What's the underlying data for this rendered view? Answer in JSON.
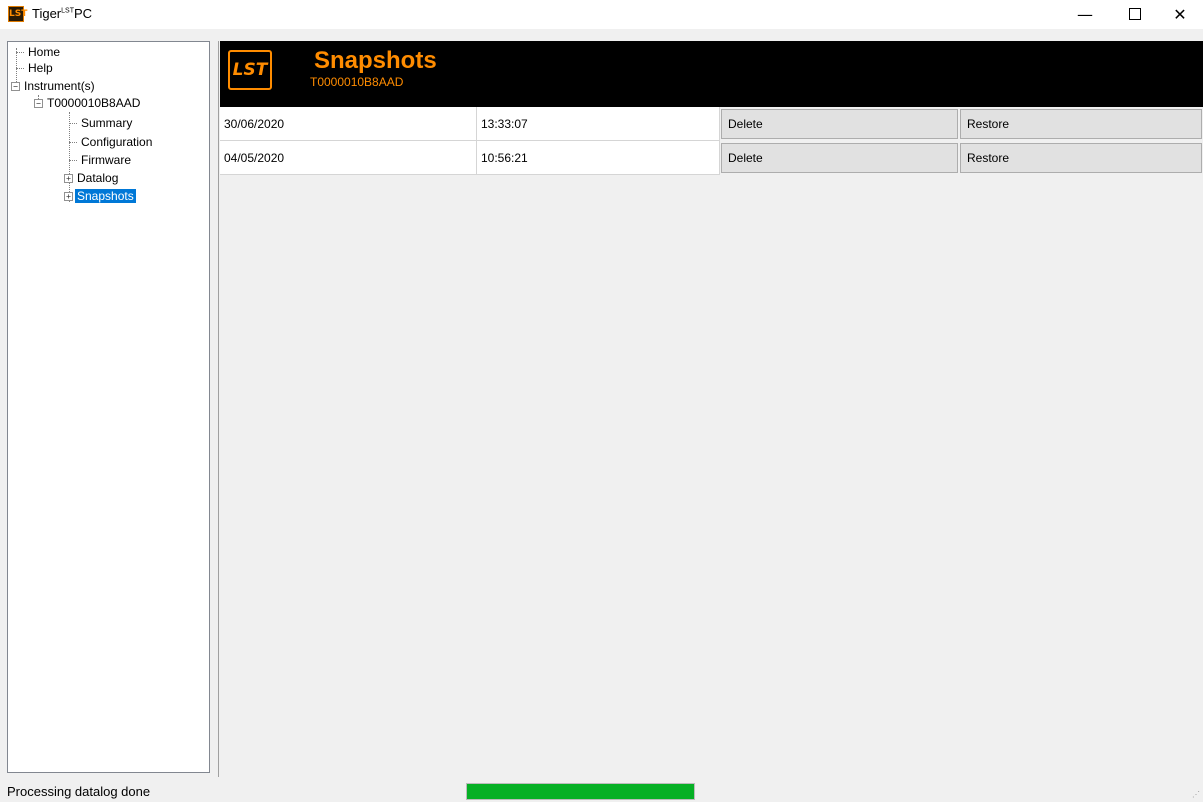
{
  "window": {
    "title_main": "Tiger",
    "title_sup": "LST",
    "title_suffix": "PC",
    "app_icon_text": "LST",
    "minimize": "—",
    "close": "✕"
  },
  "tree": {
    "home": "Home",
    "help": "Help",
    "instruments": "Instrument(s)",
    "instrument_id": "T0000010B8AAD",
    "summary": "Summary",
    "configuration": "Configuration",
    "firmware": "Firmware",
    "datalog": "Datalog",
    "snapshots": "Snapshots",
    "expand_sign": "+",
    "collapse_sign": "−"
  },
  "header": {
    "logo_text": "LST",
    "title": "Snapshots",
    "subtitle": "T0000010B8AAD"
  },
  "snapshots": [
    {
      "date": "30/06/2020",
      "time": "13:33:07",
      "delete_label": "Delete",
      "restore_label": "Restore"
    },
    {
      "date": "04/05/2020",
      "time": "10:56:21",
      "delete_label": "Delete",
      "restore_label": "Restore"
    }
  ],
  "status": {
    "text": "Processing datalog done",
    "progress": 1.0,
    "progress_color": "#06b025"
  },
  "colors": {
    "accent": "#ff8c00",
    "selection": "#0078d7"
  }
}
